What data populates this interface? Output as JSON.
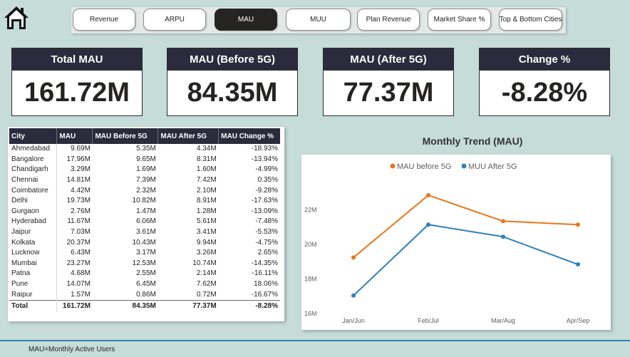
{
  "nav": {
    "buttons": [
      {
        "label": "Revenue",
        "active": false
      },
      {
        "label": "ARPU",
        "active": false
      },
      {
        "label": "MAU",
        "active": true
      },
      {
        "label": "MUU",
        "active": false
      },
      {
        "label": "Plan Revenue",
        "active": false
      },
      {
        "label": "Market Share %",
        "active": false
      },
      {
        "label": "Top & Bottom Cities",
        "active": false
      }
    ]
  },
  "kpis": [
    {
      "title": "Total MAU",
      "value": "161.72M"
    },
    {
      "title": "MAU (Before 5G)",
      "value": "84.35M"
    },
    {
      "title": "MAU (After 5G)",
      "value": "77.37M"
    },
    {
      "title": "Change %",
      "value": "-8.28%"
    }
  ],
  "table": {
    "headers": [
      "City",
      "MAU",
      "MAU Before 5G",
      "MAU After 5G",
      "MAU Change %"
    ],
    "rows": [
      [
        "Ahmedabad",
        "9.69M",
        "5.35M",
        "4.34M",
        "-18.93%"
      ],
      [
        "Bangalore",
        "17.96M",
        "9.65M",
        "8.31M",
        "-13.94%"
      ],
      [
        "Chandigarh",
        "3.29M",
        "1.69M",
        "1.60M",
        "-4.99%"
      ],
      [
        "Chennai",
        "14.81M",
        "7.39M",
        "7.42M",
        "0.35%"
      ],
      [
        "Coimbatore",
        "4.42M",
        "2.32M",
        "2.10M",
        "-9.28%"
      ],
      [
        "Delhi",
        "19.73M",
        "10.82M",
        "8.91M",
        "-17.63%"
      ],
      [
        "Gurgaon",
        "2.76M",
        "1.47M",
        "1.28M",
        "-13.09%"
      ],
      [
        "Hyderabad",
        "11.67M",
        "6.06M",
        "5.61M",
        "-7.48%"
      ],
      [
        "Jaipur",
        "7.03M",
        "3.61M",
        "3.41M",
        "-5.53%"
      ],
      [
        "Kolkata",
        "20.37M",
        "10.43M",
        "9.94M",
        "-4.75%"
      ],
      [
        "Lucknow",
        "6.43M",
        "3.17M",
        "3.26M",
        "2.65%"
      ],
      [
        "Mumbai",
        "23.27M",
        "12.53M",
        "10.74M",
        "-14.35%"
      ],
      [
        "Patna",
        "4.68M",
        "2.55M",
        "2.14M",
        "-16.11%"
      ],
      [
        "Pune",
        "14.07M",
        "6.45M",
        "7.62M",
        "18.06%"
      ],
      [
        "Raipur",
        "1.57M",
        "0.86M",
        "0.72M",
        "-16.67%"
      ]
    ],
    "total": [
      "Total",
      "161.72M",
      "84.35M",
      "77.37M",
      "-8.28%"
    ]
  },
  "chart_data": {
    "type": "line",
    "title": "Monthly Trend (MAU)",
    "xlabel": "",
    "ylabel": "",
    "categories": [
      "Jan/Jun",
      "Feb/Jul",
      "Mar/Aug",
      "Apr/Sep"
    ],
    "series": [
      {
        "name": "MAU before 5G",
        "values": [
          19.2,
          22.8,
          21.3,
          21.1
        ],
        "color": "#e8761a"
      },
      {
        "name": "MUU After 5G",
        "values": [
          17.0,
          21.1,
          20.4,
          18.8
        ],
        "color": "#2f80bd"
      }
    ],
    "ylim": [
      16,
      23.5
    ],
    "yticks": [
      16,
      18,
      20,
      22
    ],
    "ytick_labels": [
      "16M",
      "18M",
      "20M",
      "22M"
    ],
    "legend_position": "top-center",
    "grid": false
  },
  "footer": {
    "note": "MAU=Monthly Active Users"
  }
}
